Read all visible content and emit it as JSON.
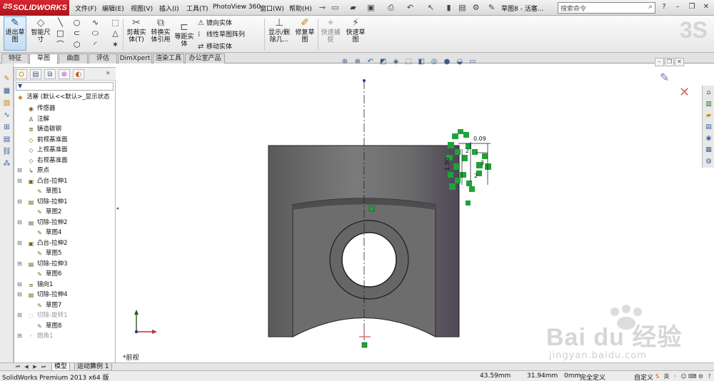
{
  "app": {
    "logo_text": "SOLIDWORKS",
    "doc_title": "草图8 - 活塞...",
    "menus": [
      "文件(F)",
      "编辑(E)",
      "视图(V)",
      "插入(I)",
      "工具(T)",
      "PhotoView 360",
      "窗口(W)",
      "帮助(H)"
    ],
    "search_placeholder": "搜索命令",
    "watermark_glyph": "3S"
  },
  "ribbon": {
    "exit_sketch": "退出草图",
    "smart_dimension": "智能尺寸",
    "trim_entities": "剪裁实体(T)",
    "convert_entities": "转换实体引用",
    "offset_entities": "等距实体",
    "mirror_entities": "镜向实体",
    "linear_pattern": "线性草图阵列",
    "move_entities": "移动实体",
    "show_delete_relations": "显示/删除几...",
    "repair_sketch": "修复草图",
    "quick_snaps": "快速捕捉",
    "rapid_sketch": "快速草图"
  },
  "tabs": [
    "特征",
    "草图",
    "曲面",
    "评估",
    "DimXpert",
    "渲染工具",
    "办公室产品"
  ],
  "active_tab": "草图",
  "tree": {
    "root": "活塞 (默认<<默认>_显示状态",
    "items": [
      {
        "label": "传感器",
        "depth": 1,
        "icon": "sensor-icon"
      },
      {
        "label": "注解",
        "depth": 1,
        "icon": "annotation-icon"
      },
      {
        "label": "铸造碳钢",
        "depth": 1,
        "icon": "material-icon"
      },
      {
        "label": "前视基准面",
        "depth": 1,
        "icon": "plane-icon"
      },
      {
        "label": "上视基准面",
        "depth": 1,
        "icon": "plane-icon"
      },
      {
        "label": "右视基准面",
        "depth": 1,
        "icon": "plane-icon"
      },
      {
        "label": "原点",
        "depth": 1,
        "icon": "origin-icon"
      },
      {
        "label": "凸台-拉伸1",
        "depth": 1,
        "icon": "boss-extrude-icon"
      },
      {
        "label": "草图1",
        "depth": 2,
        "icon": "sketch-icon"
      },
      {
        "label": "切除-拉伸1",
        "depth": 1,
        "icon": "cut-extrude-icon"
      },
      {
        "label": "草图2",
        "depth": 2,
        "icon": "sketch-icon"
      },
      {
        "label": "切除-拉伸2",
        "depth": 1,
        "icon": "cut-extrude-icon"
      },
      {
        "label": "草图4",
        "depth": 2,
        "icon": "sketch-icon"
      },
      {
        "label": "凸台-拉伸2",
        "depth": 1,
        "icon": "boss-extrude-icon"
      },
      {
        "label": "草图5",
        "depth": 2,
        "icon": "sketch-icon"
      },
      {
        "label": "切除-拉伸3",
        "depth": 1,
        "icon": "cut-extrude-icon"
      },
      {
        "label": "草图6",
        "depth": 2,
        "icon": "sketch-icon"
      },
      {
        "label": "镜向1",
        "depth": 1,
        "icon": "mirror-icon"
      },
      {
        "label": "切除-拉伸4",
        "depth": 1,
        "icon": "cut-extrude-icon"
      },
      {
        "label": "草图7",
        "depth": 2,
        "icon": "sketch-icon"
      },
      {
        "label": "切除-旋转1",
        "depth": 1,
        "icon": "cut-revolve-icon",
        "dim": true
      },
      {
        "label": "草图8",
        "depth": 2,
        "icon": "sketch-icon"
      },
      {
        "label": "圆角1",
        "depth": 1,
        "icon": "fillet-icon",
        "dim": true
      }
    ]
  },
  "graphics": {
    "view_label": "*前视",
    "dims": [
      "0.09",
      "1.50",
      "2",
      "3",
      "2"
    ]
  },
  "model_tabs": [
    "模型",
    "运动算例 1"
  ],
  "status": {
    "product": "SolidWorks Premium 2013 x64 版",
    "x": "43.59mm",
    "y": "31.94mm",
    "z": "0mm",
    "state": "完全定义",
    "units": "自定义"
  },
  "watermark": {
    "brand": "Bai du 经验",
    "url": "jingyan.baidu.com"
  },
  "colors": {
    "logo_red": "#c01d24",
    "sketch_green": "#1fa23a",
    "part_gray": "#6e6e6e",
    "ribbon_active": "#c3dcf4"
  }
}
